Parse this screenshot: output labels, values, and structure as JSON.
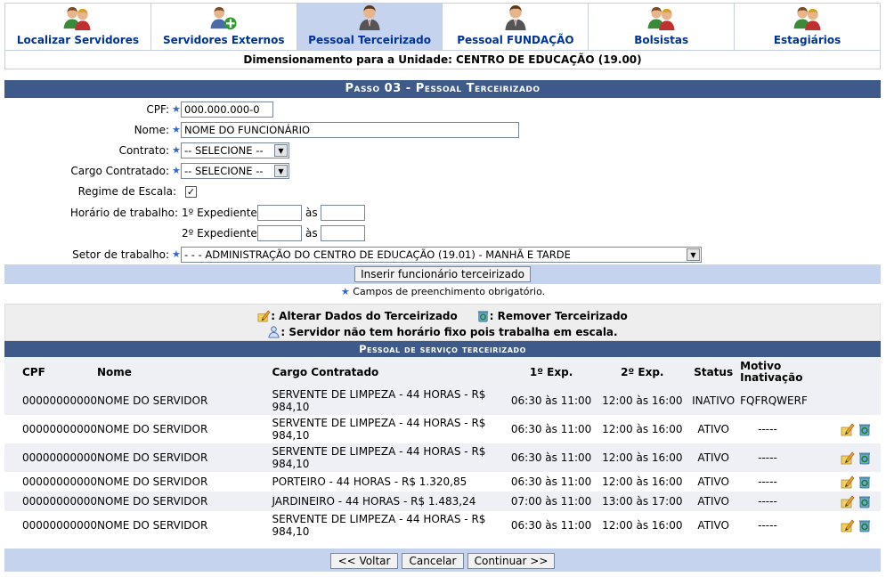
{
  "tabs": [
    {
      "label": "Localizar Servidores",
      "icon": "users-search-icon",
      "active": false
    },
    {
      "label": "Servidores Externos",
      "icon": "user-add-icon",
      "active": false
    },
    {
      "label": "Pessoal Terceirizado",
      "icon": "user-suit-icon",
      "active": true
    },
    {
      "label": "Pessoal FUNDAÇÃO",
      "icon": "user-suit-icon",
      "active": false
    },
    {
      "label": "Bolsistas",
      "icon": "users-icon",
      "active": false
    },
    {
      "label": "Estagiários",
      "icon": "users-icon",
      "active": false
    }
  ],
  "unit_bar": "Dimensionamento para a Unidade: CENTRO DE EDUCAÇÃO (19.00)",
  "form": {
    "title": "Passo 03 - Pessoal Terceirizado",
    "cpf_label": "CPF:",
    "cpf_value": "000.000.000-0",
    "nome_label": "Nome:",
    "nome_value": "NOME DO FUNCIONÁRIO",
    "contrato_label": "Contrato:",
    "contrato_value": "-- SELECIONE --",
    "cargo_label": "Cargo Contratado:",
    "cargo_value": "-- SELECIONE --",
    "regime_label": "Regime de Escala:",
    "regime_checked": true,
    "horario_label": "Horário de trabalho:",
    "exp1_label": "1º Expediente:",
    "exp2_label": "2º Expediente:",
    "as_label": "às",
    "setor_label": "Setor de trabalho:",
    "setor_value": "- - - ADMINISTRAÇÃO DO CENTRO DE EDUCAÇÃO (19.01) - MANHÃ E TARDE",
    "insert_button": "Inserir funcionário terceirizado",
    "required_note": "Campos de preenchimento obrigatório."
  },
  "legend": {
    "edit": ": Alterar Dados do Terceirizado",
    "remove": ": Remover Terceirizado",
    "no_schedule": ": Servidor não tem horário fixo pois trabalha em escala."
  },
  "list": {
    "title": "Pessoal de serviço terceirizado",
    "headers": {
      "cpf": "CPF",
      "nome": "Nome",
      "cargo": "Cargo Contratado",
      "exp1": "1º Exp.",
      "exp2": "2º Exp.",
      "status": "Status",
      "motivo": "Motivo Inativação"
    },
    "rows": [
      {
        "cpf": "00000000000",
        "nome": "NOME DO SERVIDOR",
        "cargo": "SERVENTE DE LIMPEZA - 44 HORAS - R$ 984,10",
        "exp1": "06:30 às 11:00",
        "exp2": "12:00 às 16:00",
        "status": "INATIVO",
        "motivo": "FQFRQWERF",
        "actions": false
      },
      {
        "cpf": "00000000000",
        "nome": "NOME DO SERVIDOR",
        "cargo": "SERVENTE DE LIMPEZA - 44 HORAS - R$ 984,10",
        "exp1": "06:30 às 11:00",
        "exp2": "12:00 às 16:00",
        "status": "ATIVO",
        "motivo": "-----",
        "actions": true
      },
      {
        "cpf": "00000000000",
        "nome": "NOME DO SERVIDOR",
        "cargo": "SERVENTE DE LIMPEZA - 44 HORAS - R$ 984,10",
        "exp1": "06:30 às 11:00",
        "exp2": "12:00 às 16:00",
        "status": "ATIVO",
        "motivo": "-----",
        "actions": true
      },
      {
        "cpf": "00000000000",
        "nome": "NOME DO SERVIDOR",
        "cargo": "PORTEIRO - 44 HORAS - R$ 1.320,85",
        "exp1": "06:30 às 11:00",
        "exp2": "12:00 às 16:00",
        "status": "ATIVO",
        "motivo": "-----",
        "actions": true
      },
      {
        "cpf": "00000000000",
        "nome": "NOME DO SERVIDOR",
        "cargo": "JARDINEIRO - 44 HORAS - R$ 1.483,24",
        "exp1": "07:00 às 11:00",
        "exp2": "13:00 às 17:00",
        "status": "ATIVO",
        "motivo": "-----",
        "actions": true
      },
      {
        "cpf": "00000000000",
        "nome": "NOME DO SERVIDOR",
        "cargo": "SERVENTE DE LIMPEZA - 44 HORAS - R$ 984,10",
        "exp1": "06:30 às 11:00",
        "exp2": "12:00 às 16:00",
        "status": "ATIVO",
        "motivo": "-----",
        "actions": true
      }
    ]
  },
  "footer": {
    "back_button": "<< Voltar",
    "cancel_button": "Cancelar",
    "continue_button": "Continuar >>"
  },
  "colors": {
    "header_blue": "#3d5a8a",
    "tab_active": "#c6d3ee",
    "tab_text": "#003399",
    "required_star": "#3366cc"
  }
}
